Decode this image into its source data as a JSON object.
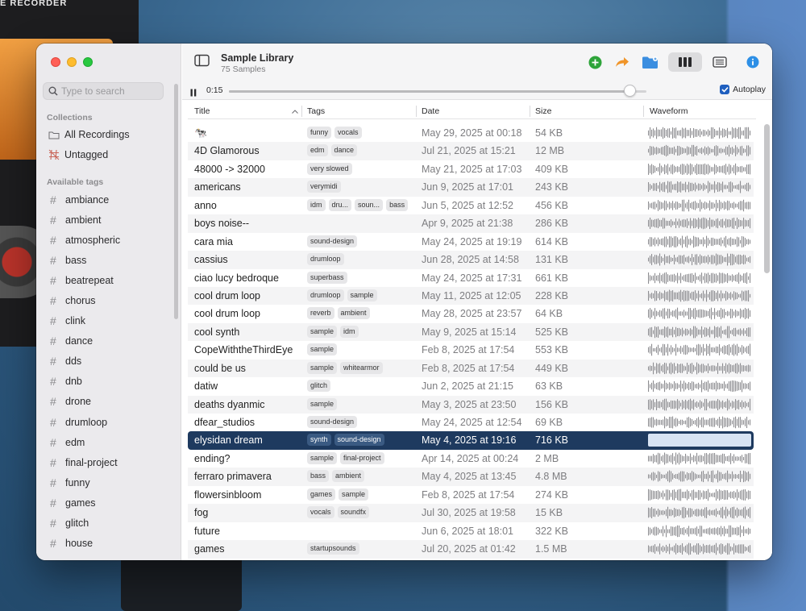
{
  "colors": {
    "accent": "#1f5fbf",
    "selected_row": "#1e3a5f",
    "add_icon": "#2ea43a",
    "share_icon": "#f0952a",
    "folder_icon": "#3b8ee0",
    "info_icon": "#2d8fe6"
  },
  "desktop": {
    "recorder_label": "E RECORDER"
  },
  "sidebar": {
    "search_placeholder": "Type to search",
    "collections_header": "Collections",
    "collections": [
      {
        "label": "All Recordings",
        "icon": "folder-icon"
      },
      {
        "label": "Untagged",
        "icon": "untagged-icon"
      }
    ],
    "tags_header": "Available tags",
    "tags": [
      "ambiance",
      "ambient",
      "atmospheric",
      "bass",
      "beatrepeat",
      "chorus",
      "clink",
      "dance",
      "dds",
      "dnb",
      "drone",
      "drumloop",
      "edm",
      "final-project",
      "funny",
      "games",
      "glitch",
      "house"
    ]
  },
  "toolbar": {
    "title": "Sample Library",
    "subtitle": "75 Samples",
    "icons": [
      "sidebar-toggle-icon",
      "add-icon",
      "share-icon",
      "folder-icon",
      "columns-view-icon",
      "list-view-icon",
      "info-icon"
    ]
  },
  "player": {
    "time": "0:15",
    "progress": 0.96,
    "autoplay_label": "Autoplay",
    "autoplay_checked": true
  },
  "table": {
    "headers": {
      "title": "Title",
      "tags": "Tags",
      "date": "Date",
      "size": "Size",
      "waveform": "Waveform"
    },
    "rows": [
      {
        "title": "🐄",
        "tags": [
          "funny",
          "vocals"
        ],
        "date": "May 29, 2025 at 00:18",
        "size": "54 KB"
      },
      {
        "title": "4D Glamorous",
        "tags": [
          "edm",
          "dance"
        ],
        "date": "Jul 21, 2025 at 15:21",
        "size": "12 MB"
      },
      {
        "title": "48000 -> 32000",
        "tags": [
          "very slowed"
        ],
        "date": "May 21, 2025 at 17:03",
        "size": "409 KB"
      },
      {
        "title": "americans",
        "tags": [
          "verymidi"
        ],
        "date": "Jun 9, 2025 at 17:01",
        "size": "243 KB"
      },
      {
        "title": "anno",
        "tags": [
          "idm",
          "dru...",
          "soun...",
          "bass"
        ],
        "date": "Jun 5, 2025 at 12:52",
        "size": "456 KB"
      },
      {
        "title": "boys noise--",
        "tags": [],
        "date": "Apr 9, 2025 at 21:38",
        "size": "286 KB"
      },
      {
        "title": "cara mia",
        "tags": [
          "sound-design"
        ],
        "date": "May 24, 2025 at 19:19",
        "size": "614 KB"
      },
      {
        "title": "cassius",
        "tags": [
          "drumloop"
        ],
        "date": "Jun 28, 2025 at 14:58",
        "size": "131 KB"
      },
      {
        "title": "ciao lucy bedroque",
        "tags": [
          "superbass"
        ],
        "date": "May 24, 2025 at 17:31",
        "size": "661 KB"
      },
      {
        "title": "cool drum loop",
        "tags": [
          "drumloop",
          "sample"
        ],
        "date": "May 11, 2025 at 12:05",
        "size": "228 KB"
      },
      {
        "title": "cool drum loop",
        "tags": [
          "reverb",
          "ambient"
        ],
        "date": "May 28, 2025 at 23:57",
        "size": "64 KB"
      },
      {
        "title": "cool synth",
        "tags": [
          "sample",
          "idm"
        ],
        "date": "May 9, 2025 at 15:14",
        "size": "525 KB"
      },
      {
        "title": "CopeWiththeThirdEye",
        "tags": [
          "sample"
        ],
        "date": "Feb 8, 2025 at 17:54",
        "size": "553 KB"
      },
      {
        "title": "could be us",
        "tags": [
          "sample",
          "whitearmor"
        ],
        "date": "Feb 8, 2025 at 17:54",
        "size": "449 KB"
      },
      {
        "title": "datiw",
        "tags": [
          "glitch"
        ],
        "date": "Jun 2, 2025 at 21:15",
        "size": "63 KB"
      },
      {
        "title": "deaths dyanmic",
        "tags": [
          "sample"
        ],
        "date": "May 3, 2025 at 23:50",
        "size": "156 KB"
      },
      {
        "title": "dfear_studios",
        "tags": [
          "sound-design"
        ],
        "date": "May 24, 2025 at 12:54",
        "size": "69 KB"
      },
      {
        "title": "elysidan dream",
        "tags": [
          "synth",
          "sound-design"
        ],
        "date": "May 4, 2025 at 19:16",
        "size": "716 KB",
        "selected": true
      },
      {
        "title": "ending?",
        "tags": [
          "sample",
          "final-project"
        ],
        "date": "Apr 14, 2025 at 00:24",
        "size": "2 MB"
      },
      {
        "title": "ferraro primavera",
        "tags": [
          "bass",
          "ambient"
        ],
        "date": "May 4, 2025 at 13:45",
        "size": "4.8 MB"
      },
      {
        "title": "flowersinbloom",
        "tags": [
          "games",
          "sample"
        ],
        "date": "Feb 8, 2025 at 17:54",
        "size": "274 KB"
      },
      {
        "title": "fog",
        "tags": [
          "vocals",
          "soundfx"
        ],
        "date": "Jul 30, 2025 at 19:58",
        "size": "15 KB"
      },
      {
        "title": "future",
        "tags": [],
        "date": "Jun 6, 2025 at 18:01",
        "size": "322 KB"
      },
      {
        "title": "games",
        "tags": [
          "startupsounds"
        ],
        "date": "Jul 20, 2025 at 01:42",
        "size": "1.5 MB"
      }
    ]
  }
}
